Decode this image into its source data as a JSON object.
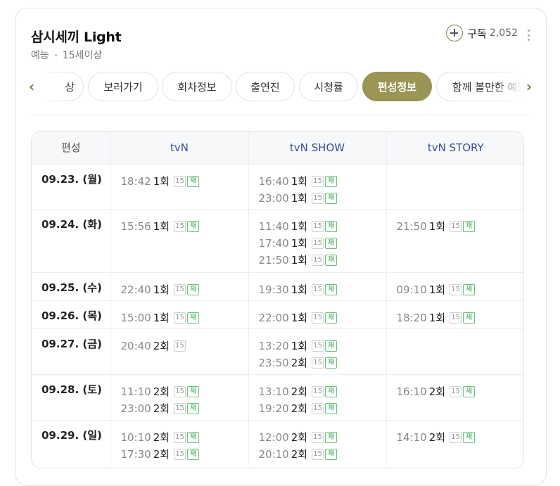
{
  "header": {
    "title": "삼시세끼 Light",
    "genre": "예능",
    "rating": "15세이상",
    "subscribe_label": "구독",
    "subscribe_count": "2,052",
    "plus_icon": "plus-circle-icon",
    "more_icon": "vertical-dots-icon"
  },
  "tabs": {
    "items": [
      "상",
      "보러가기",
      "회차정보",
      "출연진",
      "시청률",
      "편성정보",
      "함께 볼만한 예능"
    ],
    "active": "편성정보",
    "prev_icon": "chevron-left-icon",
    "next_icon": "chevron-right-icon"
  },
  "schedule": {
    "columns": [
      "편성",
      "tvN",
      "tvN SHOW",
      "tvN STORY"
    ],
    "badge_rating": "15",
    "badge_rerun": "재",
    "rows": [
      {
        "date": "09.23. (월)",
        "channels": [
          [
            {
              "time": "18:42",
              "ep": "1회",
              "rerun": true
            }
          ],
          [
            {
              "time": "16:40",
              "ep": "1회",
              "rerun": true
            },
            {
              "time": "23:00",
              "ep": "1회",
              "rerun": true
            }
          ],
          []
        ]
      },
      {
        "date": "09.24. (화)",
        "channels": [
          [
            {
              "time": "15:56",
              "ep": "1회",
              "rerun": true
            }
          ],
          [
            {
              "time": "11:40",
              "ep": "1회",
              "rerun": true
            },
            {
              "time": "17:40",
              "ep": "1회",
              "rerun": true
            },
            {
              "time": "21:50",
              "ep": "1회",
              "rerun": true
            }
          ],
          [
            {
              "time": "21:50",
              "ep": "1회",
              "rerun": true
            }
          ]
        ]
      },
      {
        "date": "09.25. (수)",
        "channels": [
          [
            {
              "time": "22:40",
              "ep": "1회",
              "rerun": true
            }
          ],
          [
            {
              "time": "19:30",
              "ep": "1회",
              "rerun": true
            }
          ],
          [
            {
              "time": "09:10",
              "ep": "1회",
              "rerun": true
            }
          ]
        ]
      },
      {
        "date": "09.26. (목)",
        "channels": [
          [
            {
              "time": "15:00",
              "ep": "1회",
              "rerun": true
            }
          ],
          [
            {
              "time": "22:00",
              "ep": "1회",
              "rerun": true
            }
          ],
          [
            {
              "time": "18:20",
              "ep": "1회",
              "rerun": true
            }
          ]
        ]
      },
      {
        "date": "09.27. (금)",
        "channels": [
          [
            {
              "time": "20:40",
              "ep": "2회",
              "rerun": false
            }
          ],
          [
            {
              "time": "13:20",
              "ep": "1회",
              "rerun": true
            },
            {
              "time": "23:50",
              "ep": "2회",
              "rerun": true
            }
          ],
          []
        ]
      },
      {
        "date": "09.28. (토)",
        "channels": [
          [
            {
              "time": "11:10",
              "ep": "2회",
              "rerun": true
            },
            {
              "time": "23:00",
              "ep": "2회",
              "rerun": true
            }
          ],
          [
            {
              "time": "13:10",
              "ep": "2회",
              "rerun": true
            },
            {
              "time": "19:20",
              "ep": "2회",
              "rerun": true
            }
          ],
          [
            {
              "time": "16:10",
              "ep": "2회",
              "rerun": true
            }
          ]
        ]
      },
      {
        "date": "09.29. (일)",
        "channels": [
          [
            {
              "time": "10:10",
              "ep": "2회",
              "rerun": true
            },
            {
              "time": "17:30",
              "ep": "2회",
              "rerun": true
            }
          ],
          [
            {
              "time": "12:00",
              "ep": "2회",
              "rerun": true
            },
            {
              "time": "20:10",
              "ep": "2회",
              "rerun": true
            }
          ],
          [
            {
              "time": "14:10",
              "ep": "2회",
              "rerun": true
            }
          ]
        ]
      }
    ]
  },
  "colors": {
    "accent": "#9a9455",
    "channel_header": "#3b4f9a",
    "rerun_badge": "#2ea84a"
  }
}
